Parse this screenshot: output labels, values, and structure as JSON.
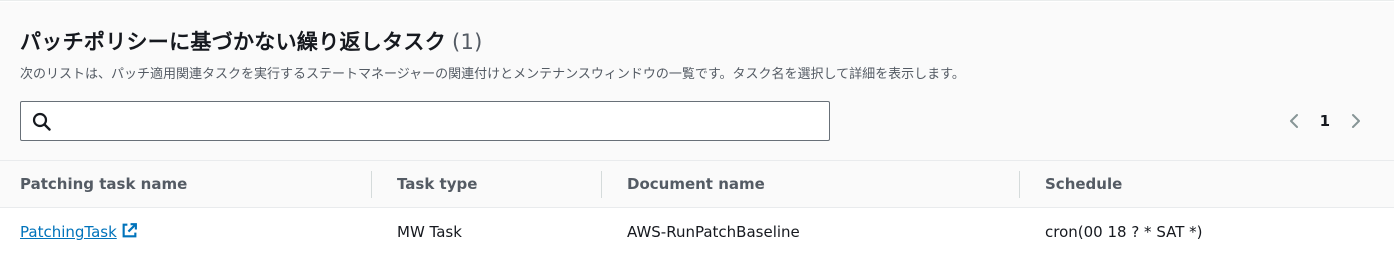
{
  "section": {
    "title": "パッチポリシーに基づかない繰り返しタスク",
    "count": "(1)",
    "description": "次のリストは、パッチ適用関連タスクを実行するステートマネージャーの関連付けとメンテナンスウィンドウの一覧です。タスク名を選択して詳細を表示します。"
  },
  "search": {
    "value": "",
    "placeholder": ""
  },
  "pagination": {
    "current_page": "1"
  },
  "table": {
    "columns": [
      "Patching task name",
      "Task type",
      "Document name",
      "Schedule"
    ],
    "rows": [
      {
        "name": "PatchingTask",
        "type": "MW Task",
        "document": "AWS-RunPatchBaseline",
        "schedule": "cron(00 18 ? * SAT *)"
      }
    ]
  },
  "colors": {
    "link": "#0073bb",
    "text": "#16191f",
    "muted": "#545b64",
    "header_bg": "#fafafa"
  },
  "icons": {
    "search": "search-icon",
    "prev": "chevron-left-icon",
    "next": "chevron-right-icon",
    "external": "external-link-icon"
  }
}
